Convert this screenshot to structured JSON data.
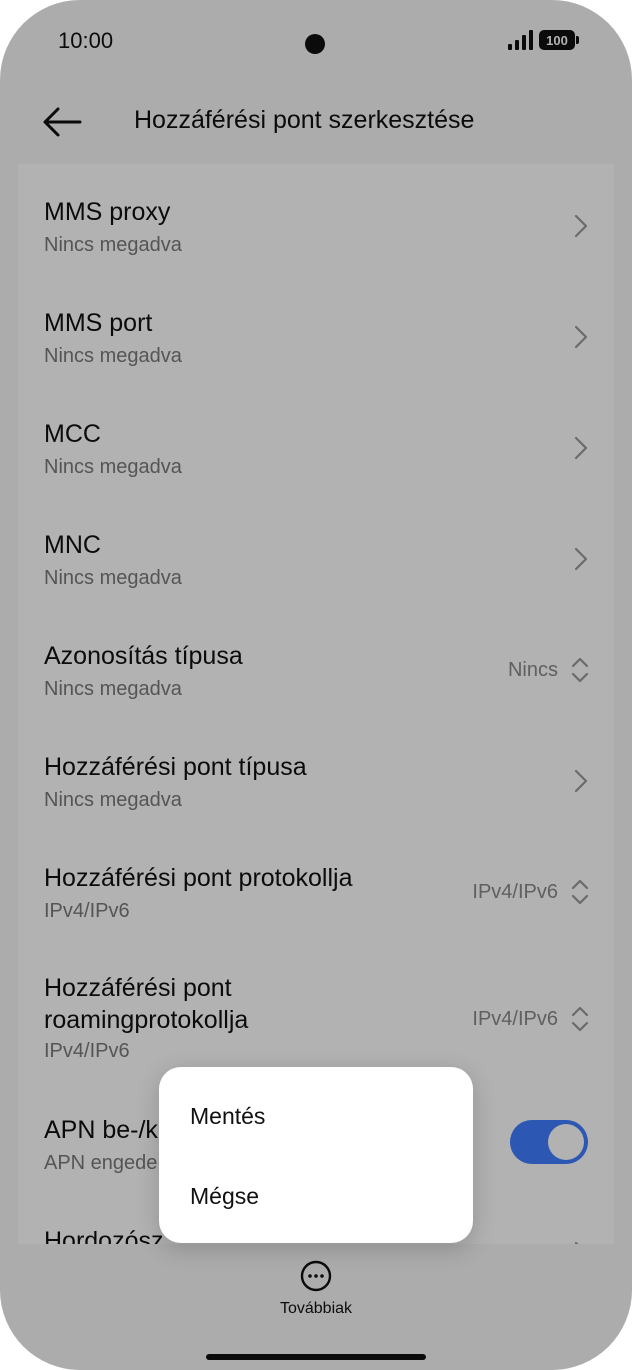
{
  "status_bar": {
    "time": "10:00",
    "battery": "100"
  },
  "header": {
    "title": "Hozzáférési pont szerkesztése"
  },
  "rows": [
    {
      "title": "MMS proxy",
      "subtitle": "Nincs megadva",
      "control": "chevron"
    },
    {
      "title": "MMS port",
      "subtitle": "Nincs megadva",
      "control": "chevron"
    },
    {
      "title": "MCC",
      "subtitle": "Nincs megadva",
      "control": "chevron"
    },
    {
      "title": "MNC",
      "subtitle": "Nincs megadva",
      "control": "chevron"
    },
    {
      "title": "Azonosítás típusa",
      "subtitle": "Nincs megadva",
      "value": "Nincs",
      "control": "updown"
    },
    {
      "title": "Hozzáférési pont típusa",
      "subtitle": "Nincs megadva",
      "control": "chevron"
    },
    {
      "title": "Hozzáférési pont protokollja",
      "subtitle": "IPv4/IPv6",
      "value": "IPv4/IPv6",
      "control": "updown"
    },
    {
      "title_line1": "Hozzáférési pont",
      "title_line2": "roamingprotokollja",
      "subtitle": "IPv4/IPv6",
      "value": "IPv4/IPv6",
      "control": "updown"
    },
    {
      "title": "APN be-/k",
      "subtitle": "APN engede",
      "control": "toggle",
      "toggle_on": true
    },
    {
      "title": "Hordozósz",
      "control": "chevron"
    }
  ],
  "popup_menu": {
    "items": [
      "Mentés",
      "Mégse"
    ]
  },
  "bottom_bar": {
    "more_label": "Továbbiak"
  },
  "colors": {
    "accent": "#3f7dff",
    "overlay": "rgba(0,0,0,0.30)"
  },
  "icons": [
    "back-arrow-icon",
    "chevron-right-icon",
    "up-down-arrows-icon",
    "more-dots-icon",
    "signal-icon",
    "battery-icon"
  ]
}
